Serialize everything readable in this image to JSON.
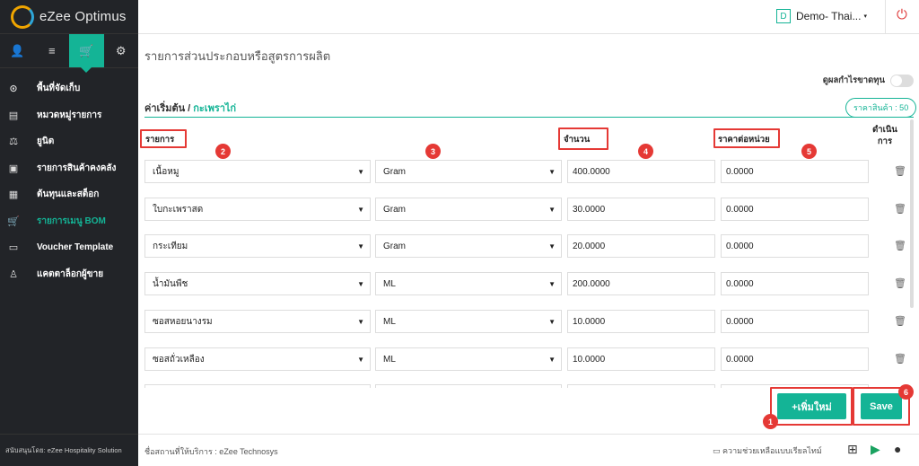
{
  "app": {
    "logo_text": "eZee Optimus"
  },
  "sidebar": {
    "tabs": [
      {
        "icon": "user-icon",
        "glyph": "👤"
      },
      {
        "icon": "menu-icon",
        "glyph": "≡"
      },
      {
        "icon": "store-icon",
        "glyph": "🛒"
      },
      {
        "icon": "gear-icon",
        "glyph": "⚙"
      }
    ],
    "items": [
      {
        "label": "พื้นที่จัดเก็บ",
        "icon": "location-icon",
        "glyph": "⊙"
      },
      {
        "label": "หมวดหมู่รายการ",
        "icon": "list-icon",
        "glyph": "▤"
      },
      {
        "label": "ยูนิต",
        "icon": "scale-icon",
        "glyph": "⚖"
      },
      {
        "label": "รายการสินค้าคงคลัง",
        "icon": "box-icon",
        "glyph": "▣"
      },
      {
        "label": "ต้นทุนและสต็อก",
        "icon": "money-icon",
        "glyph": "▦"
      },
      {
        "label": "รายการเมนู BOM",
        "icon": "cart-icon",
        "glyph": "🛒"
      },
      {
        "label": "Voucher Template",
        "icon": "voucher-icon",
        "glyph": "▭"
      },
      {
        "label": "แคตตาล็อกผู้ขาย",
        "icon": "person-icon",
        "glyph": "♙"
      }
    ],
    "footer": "สนับสนุนโดย: eZee Hospitality Solution"
  },
  "topbar": {
    "property_badge": "D",
    "property_name": "Demo- Thai...",
    "caret": "▾",
    "power_glyph": "⏻"
  },
  "page": {
    "title": "รายการส่วนประกอบหรือสูตรการผลิต",
    "toggle_label": "ดูผลกำไรขาดทุน",
    "crumb_root": "ค่าเริ่มต้น /",
    "crumb_current": "กะเพราไก่",
    "price_pill": "ราคาสินค้า : 50"
  },
  "table": {
    "headers": {
      "item": "รายการ",
      "qty": "จำนวน",
      "unit_price": "ราคาต่อหน่วย",
      "action": "ดำเนิน\nการ"
    },
    "rows": [
      {
        "item": "เนื้อหมู",
        "unit": "Gram",
        "qty": "400.0000",
        "price": "0.0000"
      },
      {
        "item": "ใบกะเพราสด",
        "unit": "Gram",
        "qty": "30.0000",
        "price": "0.0000"
      },
      {
        "item": "กระเทียม",
        "unit": "Gram",
        "qty": "20.0000",
        "price": "0.0000"
      },
      {
        "item": "น้ำมันพืช",
        "unit": "ML",
        "qty": "200.0000",
        "price": "0.0000"
      },
      {
        "item": "ซอสหอยนางรม",
        "unit": "ML",
        "qty": "10.0000",
        "price": "0.0000"
      },
      {
        "item": "ซอสถั่วเหลือง",
        "unit": "ML",
        "qty": "10.0000",
        "price": "0.0000"
      },
      {
        "item": "",
        "unit": "",
        "qty": "",
        "price": ""
      }
    ]
  },
  "annotations": [
    "1",
    "2",
    "3",
    "4",
    "5",
    "6"
  ],
  "buttons": {
    "add_new": "+เพิ่มใหม่",
    "save": "Save"
  },
  "footer": {
    "service_name": "ชื่อสถานที่ให้บริการ : eZee Technosys",
    "help": "ความช่วยเหลือแบบเรียลไทม์"
  },
  "colors": {
    "accent": "#14b496",
    "sidebar_bg": "#222428",
    "annotation": "#e53935"
  }
}
